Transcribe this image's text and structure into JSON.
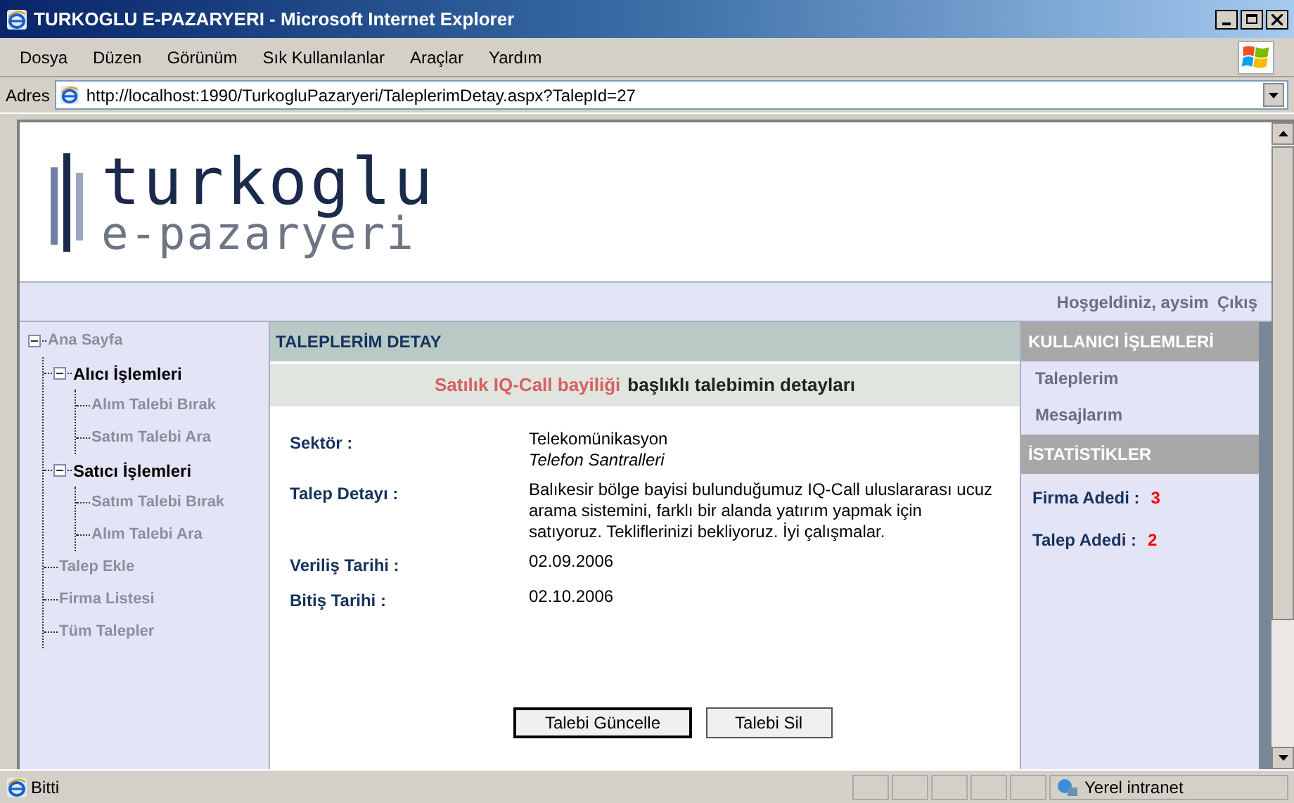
{
  "window": {
    "title": "TURKOGLU E-PAZARYERI - Microsoft Internet Explorer"
  },
  "menu": [
    "Dosya",
    "Düzen",
    "Görünüm",
    "Sık Kullanılanlar",
    "Araçlar",
    "Yardım"
  ],
  "address": {
    "label": "Adres",
    "value": "http://localhost:1990/TurkogluPazaryeri/TaleplerimDetay.aspx?TalepId=27"
  },
  "logo": {
    "name": "turkoglu",
    "tagline": "e-pazaryeri"
  },
  "welcome": {
    "text": "Hoşgeldiniz, aysim",
    "logout": "Çıkış"
  },
  "tree": [
    {
      "label": "Ana Sayfa",
      "kind": "link",
      "expanded": true,
      "children": [
        {
          "label": "Alıcı İşlemleri",
          "kind": "group",
          "expanded": true,
          "children": [
            {
              "label": "Alım Talebi Bırak",
              "kind": "link"
            },
            {
              "label": "Satım Talebi Ara",
              "kind": "link"
            }
          ]
        },
        {
          "label": "Satıcı İşlemleri",
          "kind": "group",
          "expanded": true,
          "children": [
            {
              "label": "Satım Talebi Bırak",
              "kind": "link"
            },
            {
              "label": "Alım Talebi Ara",
              "kind": "link"
            }
          ]
        },
        {
          "label": "Talep Ekle",
          "kind": "link"
        },
        {
          "label": "Firma Listesi",
          "kind": "link"
        },
        {
          "label": "Tüm Talepler",
          "kind": "link"
        }
      ]
    }
  ],
  "content": {
    "title": "TALEPLERİM DETAY",
    "subtitle_highlight": "Satılık IQ-Call bayiliği",
    "subtitle": "başlıklı talebimin detayları",
    "fields": [
      {
        "label": "Sektör :",
        "value": "Telekomünikasyon",
        "subvalue": "Telefon Santralleri"
      },
      {
        "label": "Talep Detayı :",
        "value": "Balıkesir bölge bayisi bulunduğumuz IQ-Call uluslararası ucuz arama sistemini, farklı bir alanda yatırım yapmak için satıyoruz. Tekliflerinizi bekliyoruz. İyi çalışmalar."
      },
      {
        "label": "Veriliş Tarihi :",
        "value": "02.09.2006"
      },
      {
        "label": "Bitiş Tarihi :",
        "value": "02.10.2006"
      }
    ],
    "buttons": [
      {
        "label": "Talebi Güncelle",
        "selected": true
      },
      {
        "label": "Talebi Sil",
        "selected": false
      }
    ]
  },
  "user_panel": {
    "title": "KULLANICI İŞLEMLERİ",
    "links": [
      "Taleplerim",
      "Mesajlarım"
    ]
  },
  "stats": {
    "title": "İSTATİSTİKLER",
    "items": [
      {
        "label": "Firma Adedi :",
        "value": "3"
      },
      {
        "label": "Talep Adedi :",
        "value": "2"
      }
    ]
  },
  "status_bar": {
    "text": "Bitti",
    "zone": "Yerel intranet"
  }
}
